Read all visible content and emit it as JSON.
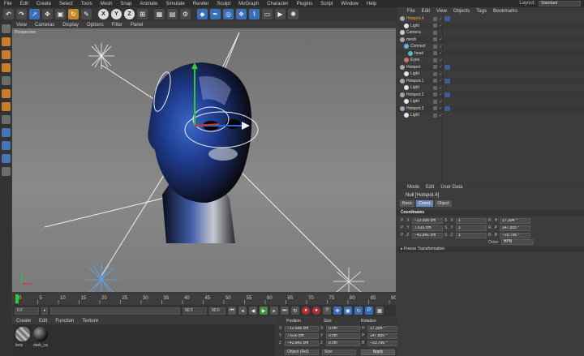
{
  "menubar": {
    "items": [
      "File",
      "Edit",
      "Create",
      "Select",
      "Tools",
      "Mesh",
      "Snap",
      "Animate",
      "Simulate",
      "Render",
      "Sculpt",
      "MoGraph",
      "Character",
      "Plugins",
      "Script",
      "Window",
      "Help"
    ],
    "layout_label": "Layout:",
    "layout_value": "Standard"
  },
  "toolbar": {
    "axis_x": "X",
    "axis_y": "Y",
    "axis_z": "Z"
  },
  "viewport": {
    "menu": [
      "View",
      "Cameras",
      "Display",
      "Options",
      "Filter",
      "Panel"
    ],
    "label": "Perspective"
  },
  "timeline": {
    "ticks": [
      "0",
      "5",
      "10",
      "15",
      "20",
      "25",
      "30",
      "35",
      "40",
      "45",
      "50",
      "55",
      "60",
      "65",
      "70",
      "75",
      "80",
      "85",
      "90"
    ],
    "current_frame": "0 F",
    "start_field": "0 F",
    "end_field": "90 F",
    "end_field2": "90 F"
  },
  "materials": {
    "menu": [
      "Create",
      "Edit",
      "Function",
      "Texture"
    ],
    "items": [
      {
        "name": "lens"
      },
      {
        "name": "dark_ca"
      }
    ]
  },
  "coords_panel": {
    "headers": [
      "Position",
      "Size",
      "Rotation"
    ],
    "rows": [
      {
        "axis": "X",
        "pos": "−12.936 cm",
        "size": "0 cm",
        "rot_axis": "H",
        "rot": "17.304 °"
      },
      {
        "axis": "Y",
        "pos": "7.616 cm",
        "size": "0 cm",
        "rot_axis": "P",
        "rot": "147.855 °"
      },
      {
        "axis": "Z",
        "pos": "−42.841 cm",
        "size": "0 cm",
        "rot_axis": "B",
        "rot": "−20.796 °"
      }
    ],
    "mode_select": "Object (Rel)",
    "size_select": "Size",
    "apply": "Apply"
  },
  "object_manager": {
    "menu": [
      "File",
      "Edit",
      "View",
      "Objects",
      "Tags",
      "Bookmarks"
    ],
    "rows": [
      {
        "name": "Hotspot.4",
        "indent": 0,
        "selected": true,
        "icon": "null-icon",
        "color": "#9aa7c9",
        "check": true,
        "tag": true
      },
      {
        "name": "Light",
        "indent": 1,
        "selected": false,
        "icon": "light-icon",
        "color": "#e5e5e5",
        "check": true,
        "tag": false
      },
      {
        "name": "Camera",
        "indent": 0,
        "selected": false,
        "icon": "camera-icon",
        "color": "#cccccc",
        "check": false,
        "tag": false
      },
      {
        "name": "mesh",
        "indent": 0,
        "selected": false,
        "icon": "null-icon",
        "color": "#9aa7c9",
        "check": true,
        "tag": false
      },
      {
        "name": "Connect",
        "indent": 1,
        "selected": false,
        "icon": "connect-icon",
        "color": "#66b3e0",
        "check": true,
        "tag": false
      },
      {
        "name": "head",
        "indent": 2,
        "selected": false,
        "icon": "mesh-icon",
        "color": "#4fc0c0",
        "check": true,
        "tag": false
      },
      {
        "name": "Eyes",
        "indent": 1,
        "selected": false,
        "icon": "eyes-icon",
        "color": "#d07070",
        "check": true,
        "tag": false
      },
      {
        "name": "Hotspot",
        "indent": 0,
        "selected": false,
        "icon": "null-icon",
        "color": "#9aa7c9",
        "check": true,
        "tag": true
      },
      {
        "name": "Light",
        "indent": 1,
        "selected": false,
        "icon": "light-icon",
        "color": "#e5e5e5",
        "check": true,
        "tag": false
      },
      {
        "name": "Hotspot.1",
        "indent": 0,
        "selected": false,
        "icon": "null-icon",
        "color": "#9aa7c9",
        "check": true,
        "tag": true
      },
      {
        "name": "Light",
        "indent": 1,
        "selected": false,
        "icon": "light-icon",
        "color": "#e5e5e5",
        "check": true,
        "tag": false
      },
      {
        "name": "Hotspot.2",
        "indent": 0,
        "selected": false,
        "icon": "null-icon",
        "color": "#9aa7c9",
        "check": true,
        "tag": true
      },
      {
        "name": "Light",
        "indent": 1,
        "selected": false,
        "icon": "light-icon",
        "color": "#e5e5e5",
        "check": true,
        "tag": false
      },
      {
        "name": "Hotspot.3",
        "indent": 0,
        "selected": false,
        "icon": "null-icon",
        "color": "#9aa7c9",
        "check": true,
        "tag": true
      },
      {
        "name": "Light",
        "indent": 1,
        "selected": false,
        "icon": "light-icon",
        "color": "#e5e5e5",
        "check": true,
        "tag": false
      }
    ]
  },
  "attribute_manager": {
    "menu": [
      "Mode",
      "Edit",
      "User Data"
    ],
    "title": "Null [Hotspot.4]",
    "tabs": [
      {
        "label": "Basic",
        "active": false
      },
      {
        "label": "Coord.",
        "active": true
      },
      {
        "label": "Object",
        "active": false
      }
    ],
    "section": "Coordinates",
    "rows": [
      {
        "p_lbl": "P . X",
        "p": "−12.936 cm",
        "s_lbl": "S . X",
        "s": "1",
        "r_lbl": "R . H",
        "r": "17.304 °"
      },
      {
        "p_lbl": "P . Y",
        "p": "7.616 cm",
        "s_lbl": "S . Y",
        "s": "1",
        "r_lbl": "R . P",
        "r": "147.855 °"
      },
      {
        "p_lbl": "P . Z",
        "p": "−42.841 cm",
        "s_lbl": "S . Z",
        "s": "1",
        "r_lbl": "R . B",
        "r": "−20.796 °"
      }
    ],
    "order_label": "Order",
    "order_value": "HPB",
    "freeze": "▸ Freeze Transformation"
  },
  "colors": {
    "accent_blue": "#3a6fb8",
    "selected_orange": "#f2a530",
    "check_green": "#49c049"
  }
}
